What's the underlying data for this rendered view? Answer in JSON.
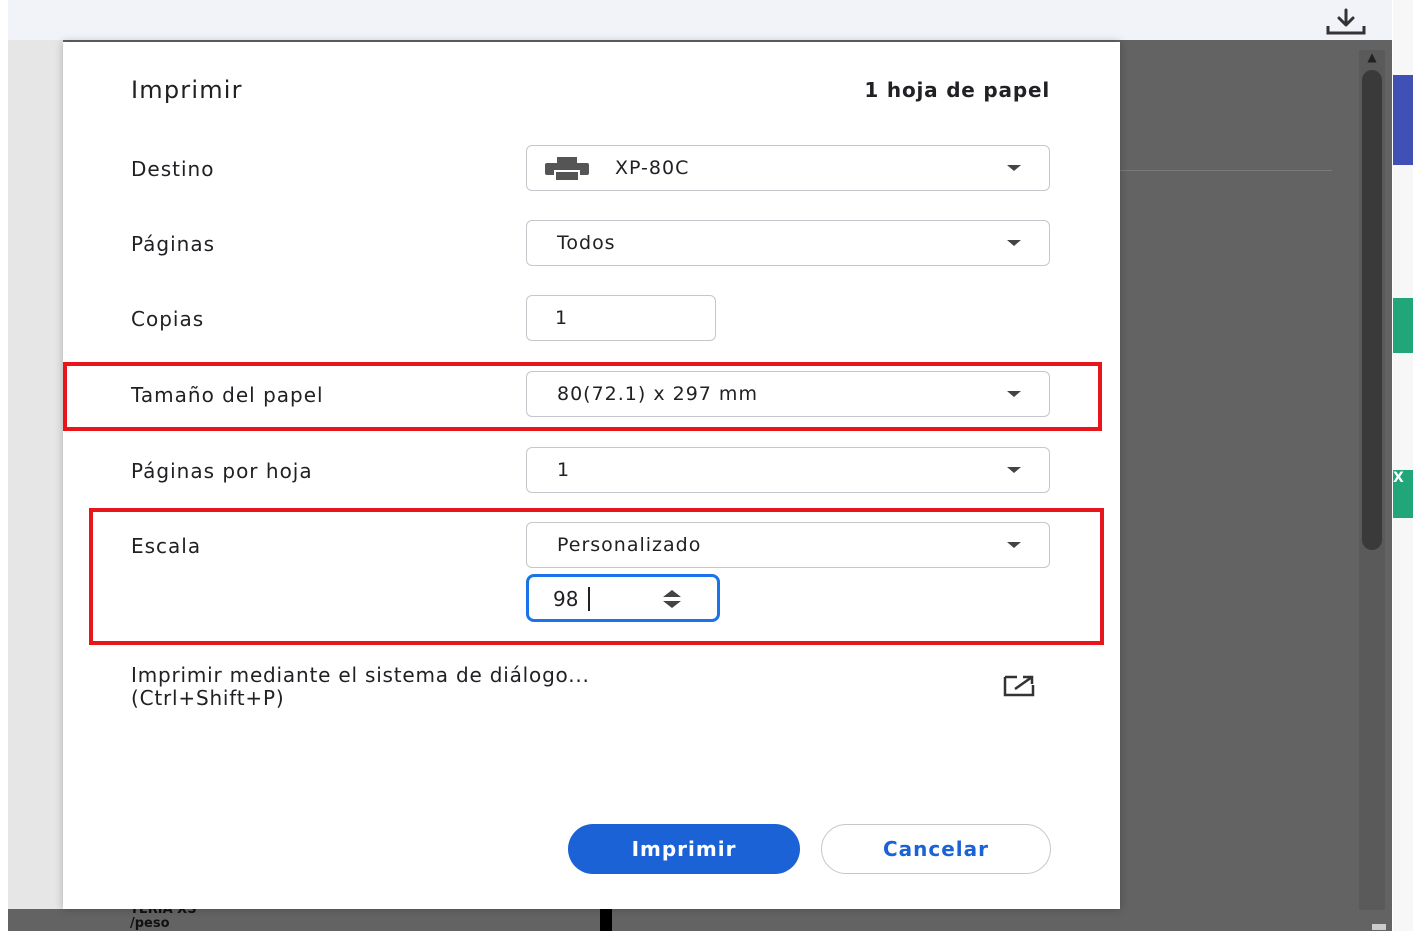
{
  "dialog": {
    "title": "Imprimir",
    "sheet_count": "1 hoja de papel",
    "destination": {
      "label": "Destino",
      "value": "XP-80C",
      "icon": "printer-icon"
    },
    "pages": {
      "label": "Páginas",
      "value": "Todos"
    },
    "copies": {
      "label": "Copias",
      "value": "1"
    },
    "paper_size": {
      "label": "Tamaño del papel",
      "value": "80(72.1) x 297 mm"
    },
    "pages_per_sheet": {
      "label": "Páginas por hoja",
      "value": "1"
    },
    "scale": {
      "label": "Escala",
      "value": "Personalizado",
      "custom_value": "98"
    },
    "system_dialog": {
      "line1": "Imprimir mediante el sistema de diálogo...",
      "line2": "(Ctrl+Shift+P)",
      "icon": "open-external-icon"
    },
    "buttons": {
      "print": "Imprimir",
      "cancel": "Cancelar"
    }
  },
  "background": {
    "preview_text_line1": "TERIA XS",
    "preview_text_line2": "/peso",
    "side_tab_label": "X"
  },
  "colors": {
    "accent": "#1a62d6",
    "highlight": "#e8161b",
    "overlay": "#636363"
  }
}
